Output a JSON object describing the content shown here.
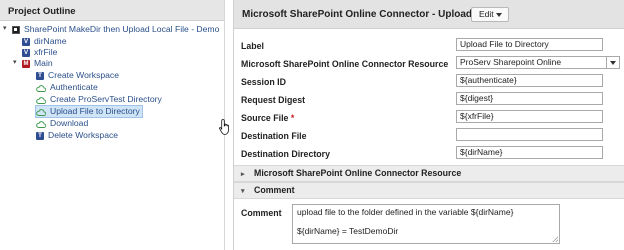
{
  "outline": {
    "header": "Project Outline",
    "items": [
      {
        "label": "SharePoint MakeDir then Upload Local File - Demo",
        "icon": "flow-icon"
      },
      {
        "label": "dirName",
        "icon": "variable-icon",
        "glyph": "V"
      },
      {
        "label": "xfrFile",
        "icon": "variable-icon",
        "glyph": "V"
      },
      {
        "label": "Main",
        "icon": "module-icon",
        "glyph": "M"
      },
      {
        "label": "Create Workspace",
        "icon": "task-icon",
        "glyph": "T"
      },
      {
        "label": "Authenticate",
        "icon": "cloud-icon"
      },
      {
        "label": "Create ProServTest Directory",
        "icon": "cloud-icon"
      },
      {
        "label": "Upload File to Directory",
        "icon": "cloud-icon",
        "selected": true
      },
      {
        "label": "Download",
        "icon": "cloud-icon"
      },
      {
        "label": "Delete Workspace",
        "icon": "task-icon",
        "glyph": "T"
      }
    ]
  },
  "panel": {
    "title": "Microsoft SharePoint Online Connector - Upload",
    "edit_label": "Edit",
    "properties": [
      {
        "label": "Label",
        "value": "Upload File to Directory",
        "required": false
      },
      {
        "label": "Microsoft SharePoint Online Connector Resource",
        "value": "ProServ Sharepoint Online",
        "required": false
      },
      {
        "label": "Session ID",
        "value": "${authenticate}",
        "required": false
      },
      {
        "label": "Request Digest",
        "value": "${digest}",
        "required": false
      },
      {
        "label": "Source File",
        "value": "${xfrFile}",
        "required": true
      },
      {
        "label": "Destination File",
        "value": "",
        "required": false
      },
      {
        "label": "Destination Directory",
        "value": "${dirName}",
        "required": false
      }
    ],
    "required_marker": "*",
    "sections": [
      {
        "label": "Microsoft SharePoint Online Connector Resource",
        "expanded": false
      },
      {
        "label": "Comment",
        "expanded": true
      }
    ],
    "comment": {
      "label": "Comment",
      "line1": "upload file to the folder defined in the variable ${dirName}",
      "line2": "${dirName} = TestDemoDir"
    }
  },
  "colors": {
    "tree_text": "#2b4f8a",
    "selected_bg": "#cfe4f7",
    "required": "#c81e1e",
    "header_bg": "#e3e3e3"
  }
}
